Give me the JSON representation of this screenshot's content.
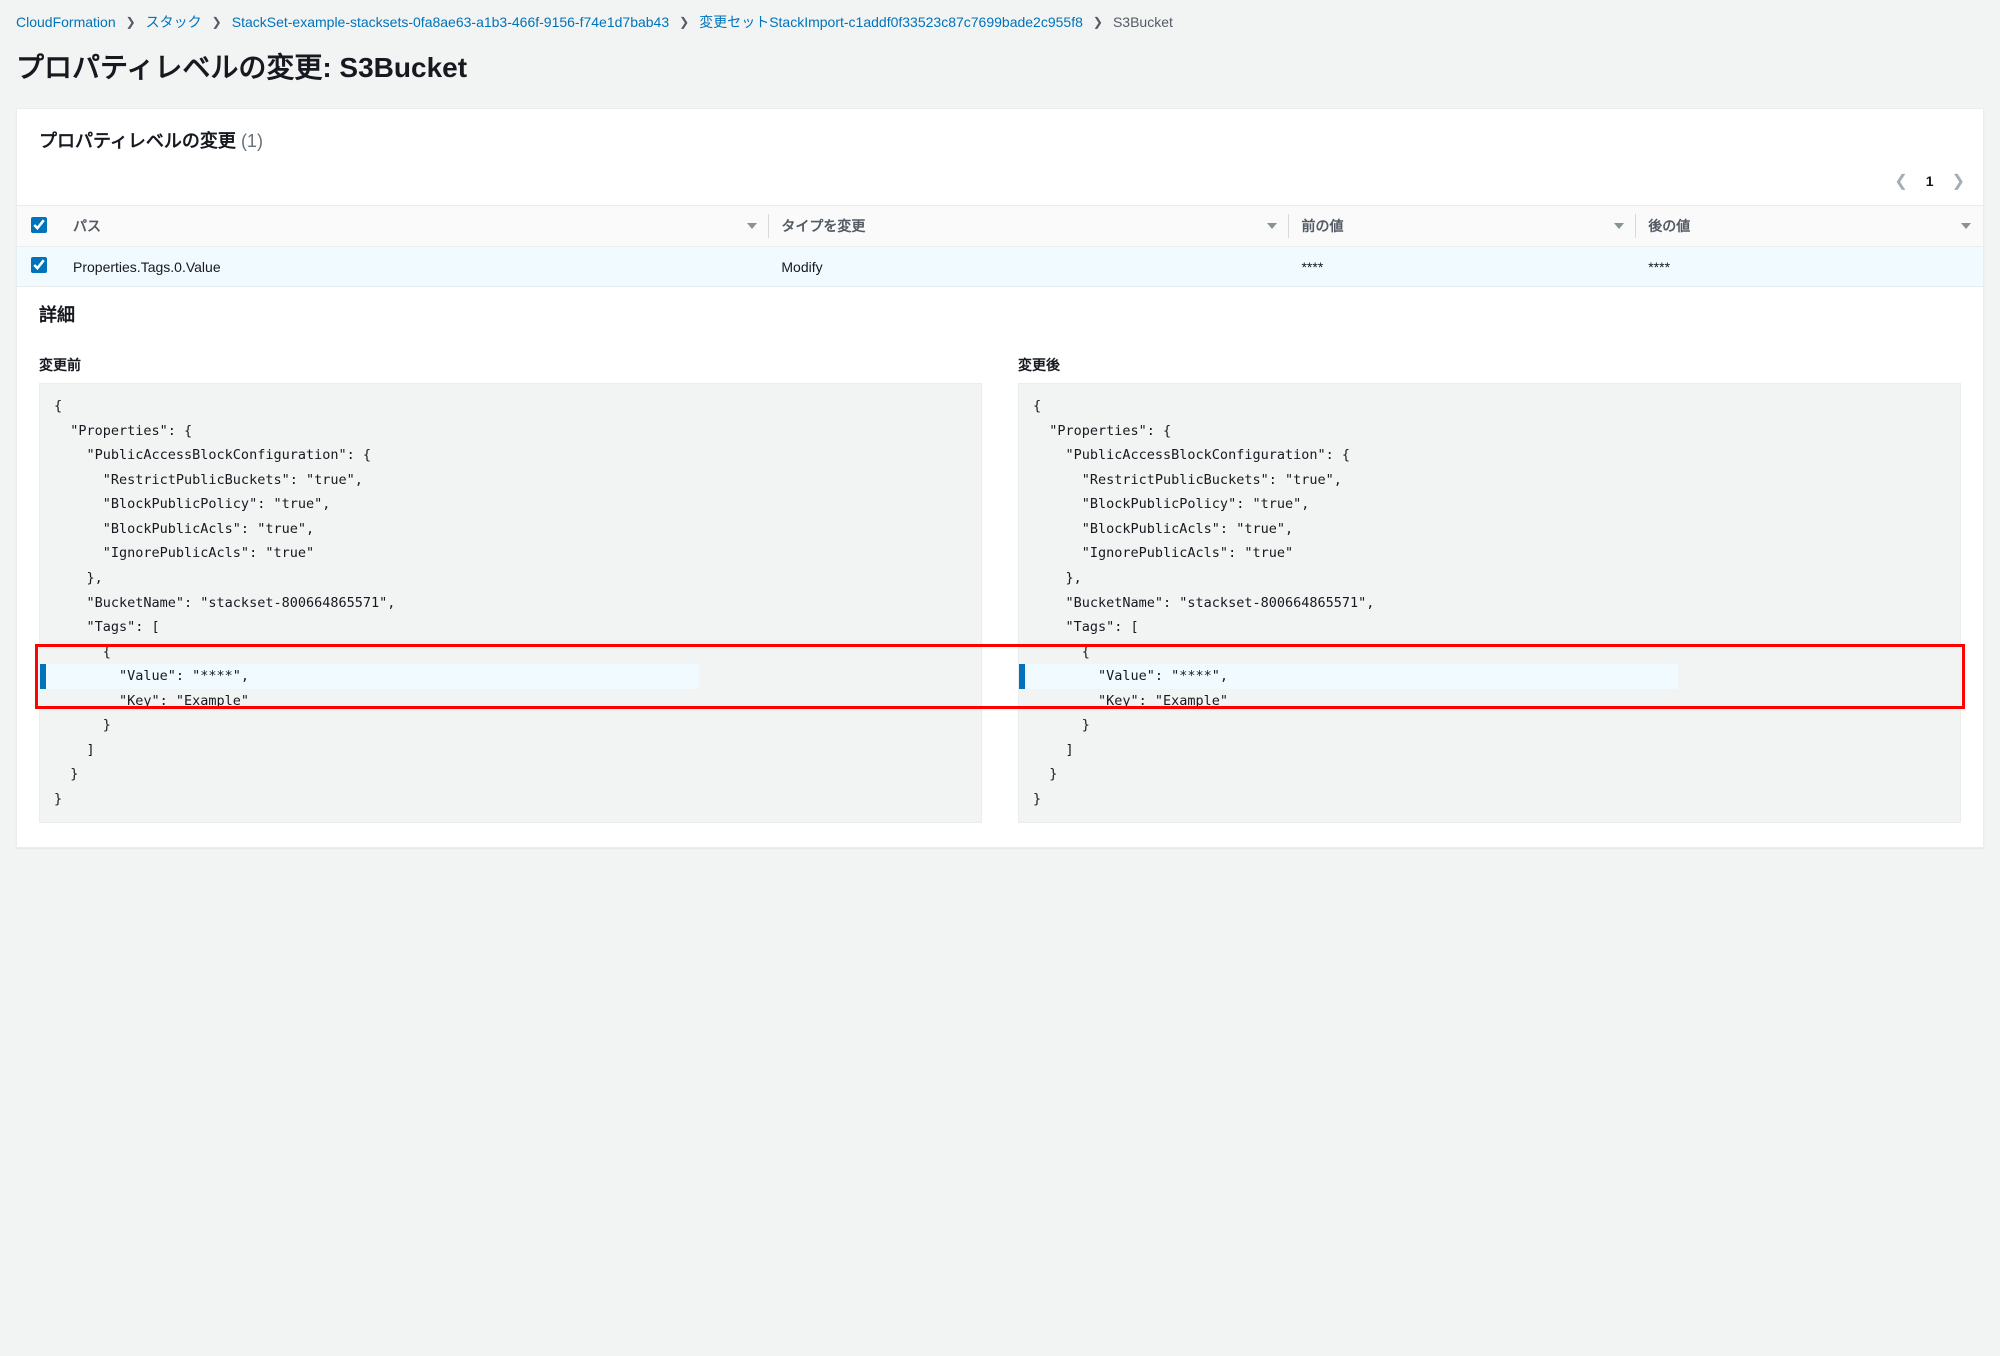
{
  "breadcrumb": {
    "items": [
      {
        "label": "CloudFormation"
      },
      {
        "label": "スタック"
      },
      {
        "label": "StackSet-example-stacksets-0fa8ae63-a1b3-466f-9156-f74e1d7bab43"
      },
      {
        "label": "変更セットStackImport-c1addf0f33523c87c7699bade2c955f8"
      }
    ],
    "current": "S3Bucket"
  },
  "page_title": "プロパティレベルの変更: S3Bucket",
  "panel": {
    "title": "プロパティレベルの変更",
    "count": "(1)"
  },
  "pagination": {
    "page": "1"
  },
  "table": {
    "headers": {
      "path": "パス",
      "change_type": "タイプを変更",
      "before": "前の値",
      "after": "後の値"
    },
    "rows": [
      {
        "path": "Properties.Tags.0.Value",
        "change_type": "Modify",
        "before": "****",
        "after": "****"
      }
    ]
  },
  "details": {
    "title": "詳細",
    "before_label": "変更前",
    "after_label": "変更後",
    "before_code": [
      "{",
      "  \"Properties\": {",
      "    \"PublicAccessBlockConfiguration\": {",
      "      \"RestrictPublicBuckets\": \"true\",",
      "      \"BlockPublicPolicy\": \"true\",",
      "      \"BlockPublicAcls\": \"true\",",
      "      \"IgnorePublicAcls\": \"true\"",
      "    },",
      "    \"BucketName\": \"stackset-800664865571\",",
      "    \"Tags\": [",
      "      {",
      "        \"Value\": \"****\",",
      "        \"Key\": \"Example\"",
      "      }",
      "    ]",
      "  }",
      "}"
    ],
    "after_code": [
      "{",
      "  \"Properties\": {",
      "    \"PublicAccessBlockConfiguration\": {",
      "      \"RestrictPublicBuckets\": \"true\",",
      "      \"BlockPublicPolicy\": \"true\",",
      "      \"BlockPublicAcls\": \"true\",",
      "      \"IgnorePublicAcls\": \"true\"",
      "    },",
      "    \"BucketName\": \"stackset-800664865571\",",
      "    \"Tags\": [",
      "      {",
      "        \"Value\": \"****\",",
      "        \"Key\": \"Example\"",
      "      }",
      "    ]",
      "  }",
      "}"
    ],
    "highlight_line_index": 11
  }
}
